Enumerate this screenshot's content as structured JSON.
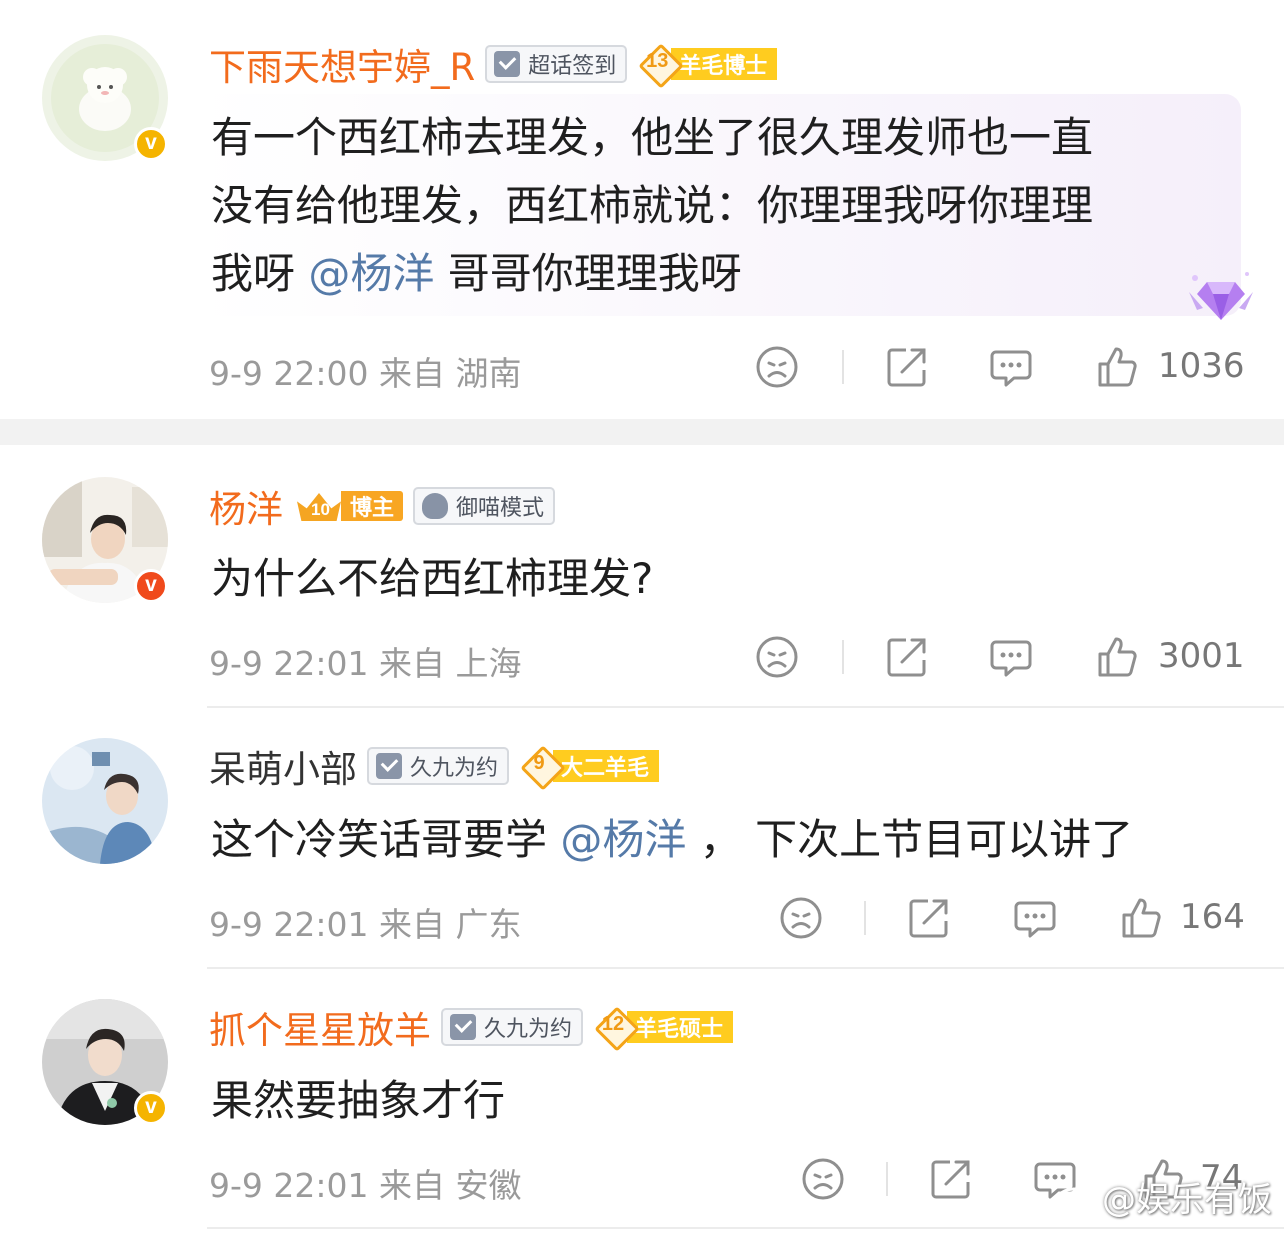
{
  "comments": [
    {
      "username": "下雨天想宇婷_R",
      "tag_label": "超话签到",
      "level_num": "13",
      "level_name": "羊毛博士",
      "text_lines": [
        "有一个西红柿去理发，他坐了很久理发师也一直",
        "没有给他理发，西红柿就说：你理理我呀你理理"
      ],
      "line3_pre": "我呀 ",
      "mention": "@杨洋",
      "line3_post": " 哥哥你理理我呀",
      "time": "9-9 22:00",
      "from": "来自 湖南",
      "likes": "1036"
    },
    {
      "username": "杨洋",
      "crown_num": "10",
      "crown_name": "博主",
      "tag_label": "御喵模式",
      "text": "为什么不给西红柿理发?",
      "time": "9-9 22:01",
      "from": "来自 上海",
      "likes": "3001"
    },
    {
      "username": "呆萌小部",
      "tag_label": "久九为约",
      "level_num": "9",
      "level_name": "大二羊毛",
      "text_pre": "这个冷笑话哥要学 ",
      "mention": "@杨洋",
      "text_post": " ， 下次上节目可以讲了",
      "time": "9-9 22:01",
      "from": "来自 广东",
      "likes": "164"
    },
    {
      "username": "抓个星星放羊",
      "tag_label": "久九为约",
      "level_num": "12",
      "level_name": "羊毛硕士",
      "text": "果然要抽象才行",
      "time": "9-9 22:01",
      "from": "来自 安徽",
      "likes": "74"
    }
  ],
  "verified_glyph": "v",
  "watermark": "@娱乐有饭",
  "colors": {
    "username_orange": "#f26b1d",
    "mention": "#557aa8",
    "meta_gray": "#9a9a9a"
  },
  "icons": [
    "dislike-icon",
    "share-icon",
    "comment-icon",
    "like-icon",
    "premium-gem-icon",
    "weibo-logo-icon"
  ]
}
